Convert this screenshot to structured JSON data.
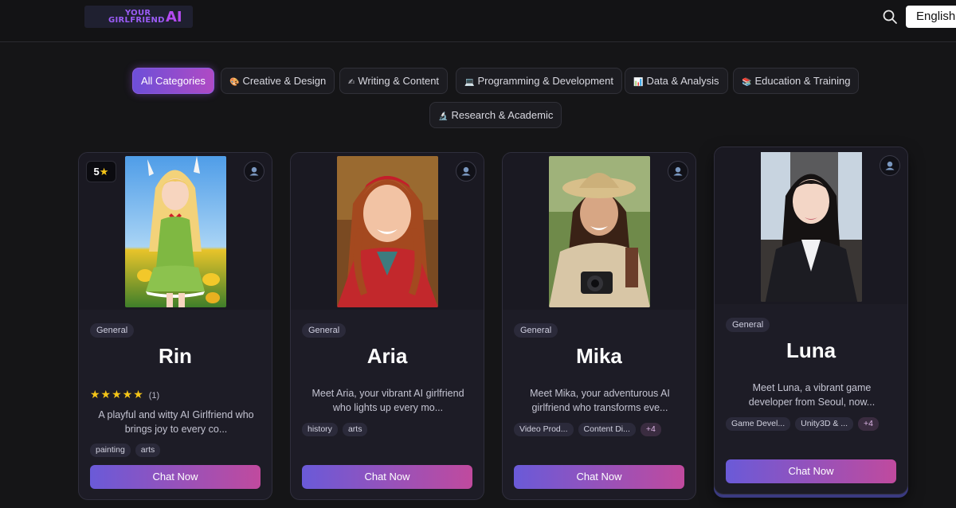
{
  "header": {
    "logo_line1": "YOUR",
    "logo_line2": "GIRLFRIEND",
    "logo_ai": "AI",
    "search_icon": "search-icon",
    "language": "English"
  },
  "categories": [
    {
      "label": "All Categories",
      "emoji": "",
      "active": true
    },
    {
      "label": "Creative & Design",
      "emoji": "🎨",
      "active": false
    },
    {
      "label": "Writing & Content",
      "emoji": "✍",
      "active": false
    },
    {
      "label": "Programming & Development",
      "emoji": "💻",
      "active": false
    },
    {
      "label": "Data & Analysis",
      "emoji": "📊",
      "active": false
    },
    {
      "label": "Education & Training",
      "emoji": "📚",
      "active": false
    },
    {
      "label": "Research & Academic",
      "emoji": "🔬",
      "active": false
    }
  ],
  "cards": [
    {
      "name": "Rin",
      "category": "General",
      "rating_badge": "5",
      "stars": "★★★★★",
      "rating_count": "(1)",
      "description": "A playful and witty AI Girlfriend who brings joy to every co...",
      "tags": [
        "painting",
        "arts"
      ],
      "cta": "Chat Now"
    },
    {
      "name": "Aria",
      "category": "General",
      "description": "Meet Aria, your vibrant AI girlfriend who lights up every mo...",
      "tags": [
        "history",
        "arts"
      ],
      "cta": "Chat Now"
    },
    {
      "name": "Mika",
      "category": "General",
      "description": "Meet Mika, your adventurous AI girlfriend who transforms eve...",
      "tags": [
        "Video Prod...",
        "Content Di..."
      ],
      "more": "+4",
      "cta": "Chat Now"
    },
    {
      "name": "Luna",
      "category": "General",
      "description": "Meet Luna, a vibrant game developer from Seoul, now...",
      "tags": [
        "Game Devel...",
        "Unity3D & ..."
      ],
      "more": "+4",
      "cta": "Chat Now"
    }
  ],
  "colors": {
    "accent_start": "#6a5ad8",
    "accent_end": "#c04a9e",
    "star": "#f5c518",
    "background": "#151517"
  }
}
